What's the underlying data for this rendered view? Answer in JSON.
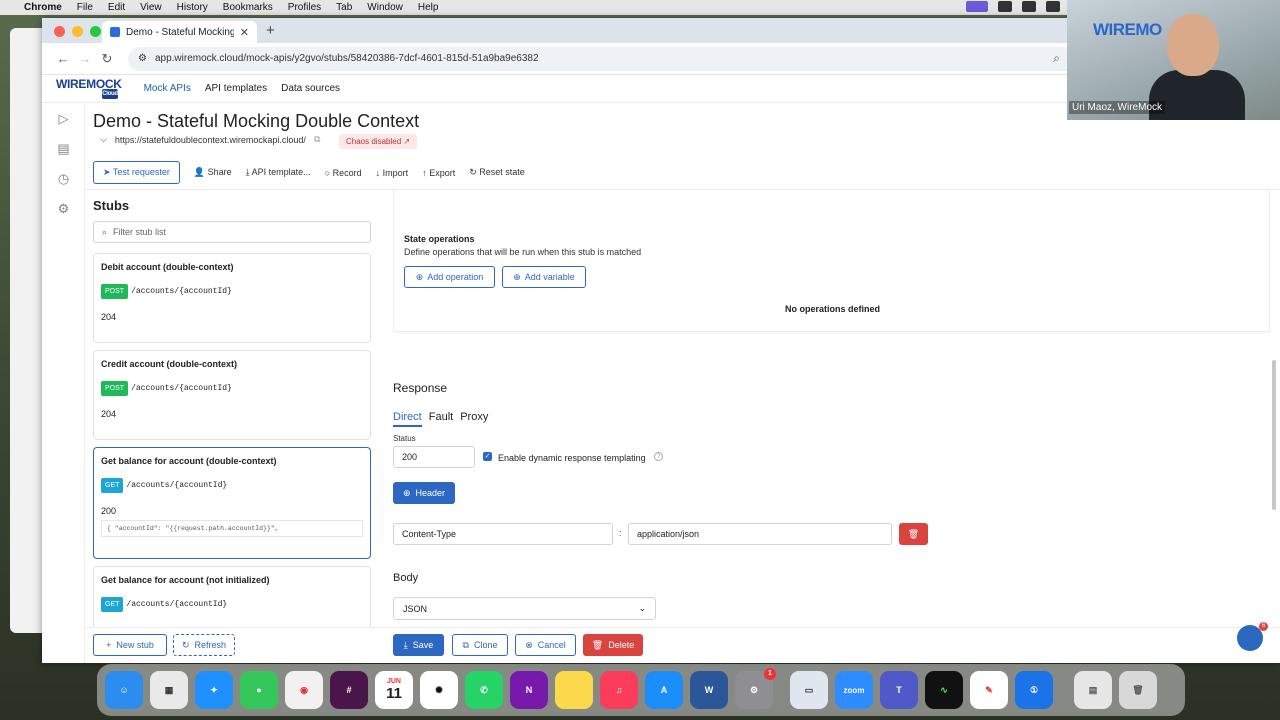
{
  "menubar": {
    "app": "Chrome",
    "items": [
      "File",
      "Edit",
      "View",
      "History",
      "Bookmarks",
      "Profiles",
      "Tab",
      "Window",
      "Help"
    ]
  },
  "browser": {
    "tab_title": "Demo - Stateful Mocking Do",
    "url": "app.wiremock.cloud/mock-apis/y2gvo/stubs/58420386-7dcf-4601-815d-51a9ba9e6382"
  },
  "app": {
    "logo": "WIREMOCK",
    "logo_sub": "Cloud",
    "nav": [
      "Mock APIs",
      "API templates",
      "Data sources"
    ]
  },
  "page": {
    "title": "Demo - Stateful Mocking Double Context",
    "base_url": "https://statefuldoublecontext.wiremockapi.cloud/",
    "chaos": "Chaos disabled",
    "toolbar": {
      "test_requester": "Test requester",
      "share": "Share",
      "api_template": "API template...",
      "record": "Record",
      "import": "Import",
      "export": "Export",
      "reset_state": "Reset state"
    }
  },
  "stubs": {
    "title": "Stubs",
    "filter_placeholder": "Filter stub list",
    "items": [
      {
        "name": "Debit account (double-context)",
        "method": "POST",
        "path": "/accounts/{accountId}",
        "status": "204"
      },
      {
        "name": "Credit account (double-context)",
        "method": "POST",
        "path": "/accounts/{accountId}",
        "status": "204"
      },
      {
        "name": "Get balance for account (double-context)",
        "method": "GET",
        "path": "/accounts/{accountId}",
        "status": "200",
        "body": "{ \"accountId\": \"{{request.path.accountId}}\","
      },
      {
        "name": "Get balance for account (not initialized)",
        "method": "GET",
        "path": "/accounts/{accountId}"
      }
    ],
    "new_stub": "New stub",
    "refresh": "Refresh"
  },
  "state_ops": {
    "title": "State operations",
    "desc": "Define operations that will be run when this stub is matched",
    "add_operation": "Add operation",
    "add_variable": "Add variable",
    "empty": "No operations defined"
  },
  "response": {
    "title": "Response",
    "tabs": [
      "Direct",
      "Fault",
      "Proxy"
    ],
    "status_label": "Status",
    "status_value": "200",
    "templating_label": "Enable dynamic response templating",
    "templating_checked": true,
    "header_button": "Header",
    "header_name": "Content-Type",
    "header_value": "application/json",
    "body_title": "Body",
    "body_type": "JSON"
  },
  "actions": {
    "save": "Save",
    "clone": "Clone",
    "cancel": "Cancel",
    "delete": "Delete"
  },
  "webcam": {
    "caption": "Uri Maoz, WireMock",
    "sign": "WIREMO"
  },
  "chat": {
    "badge": "6"
  },
  "dock": {
    "calendar_month": "JUN",
    "calendar_day": "11",
    "zoom": "zoom",
    "badge": "1"
  },
  "colors": {
    "primary": "#2c68c2",
    "post": "#1fb85a",
    "get": "#1ea5d8",
    "danger": "#d9443f"
  }
}
